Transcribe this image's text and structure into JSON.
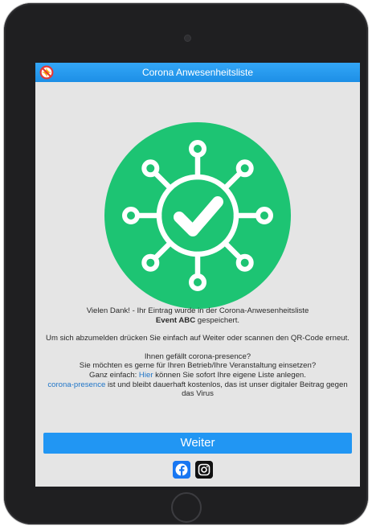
{
  "app": {
    "title": "Corona Anwesenheitsliste",
    "title_icon": "no-virus-icon",
    "accent_color": "#2196f3",
    "success_color": "#1dc473"
  },
  "status": {
    "icon": "virus-check-icon"
  },
  "message": {
    "thanks_prefix": "Vielen Dank! - Ihr Eintrag wurde in der Corona-Anwesenheitsliste",
    "event_name": "Event ABC",
    "thanks_suffix": " gespeichert.",
    "logout_hint": "Um sich abzumelden drücken Sie einfach auf Weiter oder scannen den QR-Code erneut.",
    "promo_question": "Ihnen gefällt corona-presence?",
    "promo_use": "Sie möchten es gerne für Ihren Betrieb/Ihre Veranstaltung einsetzen?",
    "promo_easy_prefix": "Ganz einfach: ",
    "promo_link_here": "Hier",
    "promo_easy_suffix": " können Sie sofort Ihre eigene Liste anlegen.",
    "promo_brand_link": "corona-presence",
    "promo_free": " ist und bleibt dauerhaft kostenlos, das ist unser digitaler Beitrag gegen das Virus"
  },
  "actions": {
    "continue_label": "Weiter"
  },
  "social": {
    "facebook_icon": "facebook-icon",
    "instagram_icon": "instagram-icon"
  }
}
